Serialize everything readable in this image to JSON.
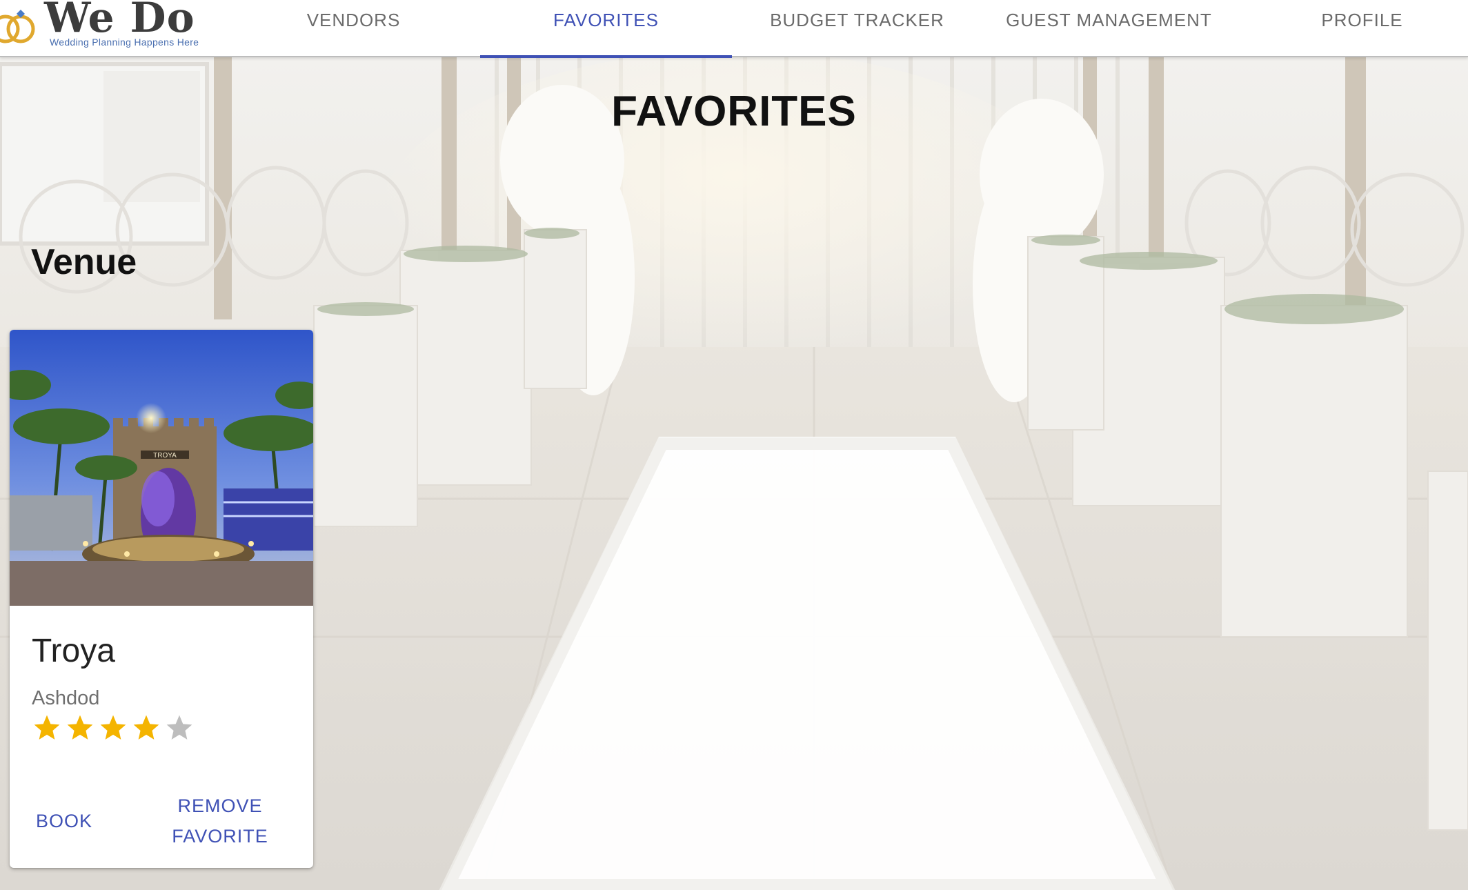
{
  "app": {
    "logo_title": "We Do",
    "logo_tagline": "Wedding Planning Happens Here"
  },
  "nav": {
    "tabs": [
      {
        "label": "VENDORS",
        "active": false
      },
      {
        "label": "FAVORITES",
        "active": true
      },
      {
        "label": "BUDGET TRACKER",
        "active": false
      },
      {
        "label": "GUEST MANAGEMENT",
        "active": false
      },
      {
        "label": "PROFILE",
        "active": false
      }
    ]
  },
  "page": {
    "title": "FAVORITES"
  },
  "sections": [
    {
      "title": "Venue",
      "cards": [
        {
          "name": "Troya",
          "city": "Ashdod",
          "image_sign": "TROYA",
          "rating": 4,
          "rating_max": 5,
          "actions": {
            "book": "BOOK",
            "remove_line1": "REMOVE",
            "remove_line2": "FAVORITE"
          }
        }
      ]
    }
  ],
  "colors": {
    "accent": "#3f51b5",
    "star_filled": "#f4b400",
    "star_empty": "#bdbdbd"
  }
}
